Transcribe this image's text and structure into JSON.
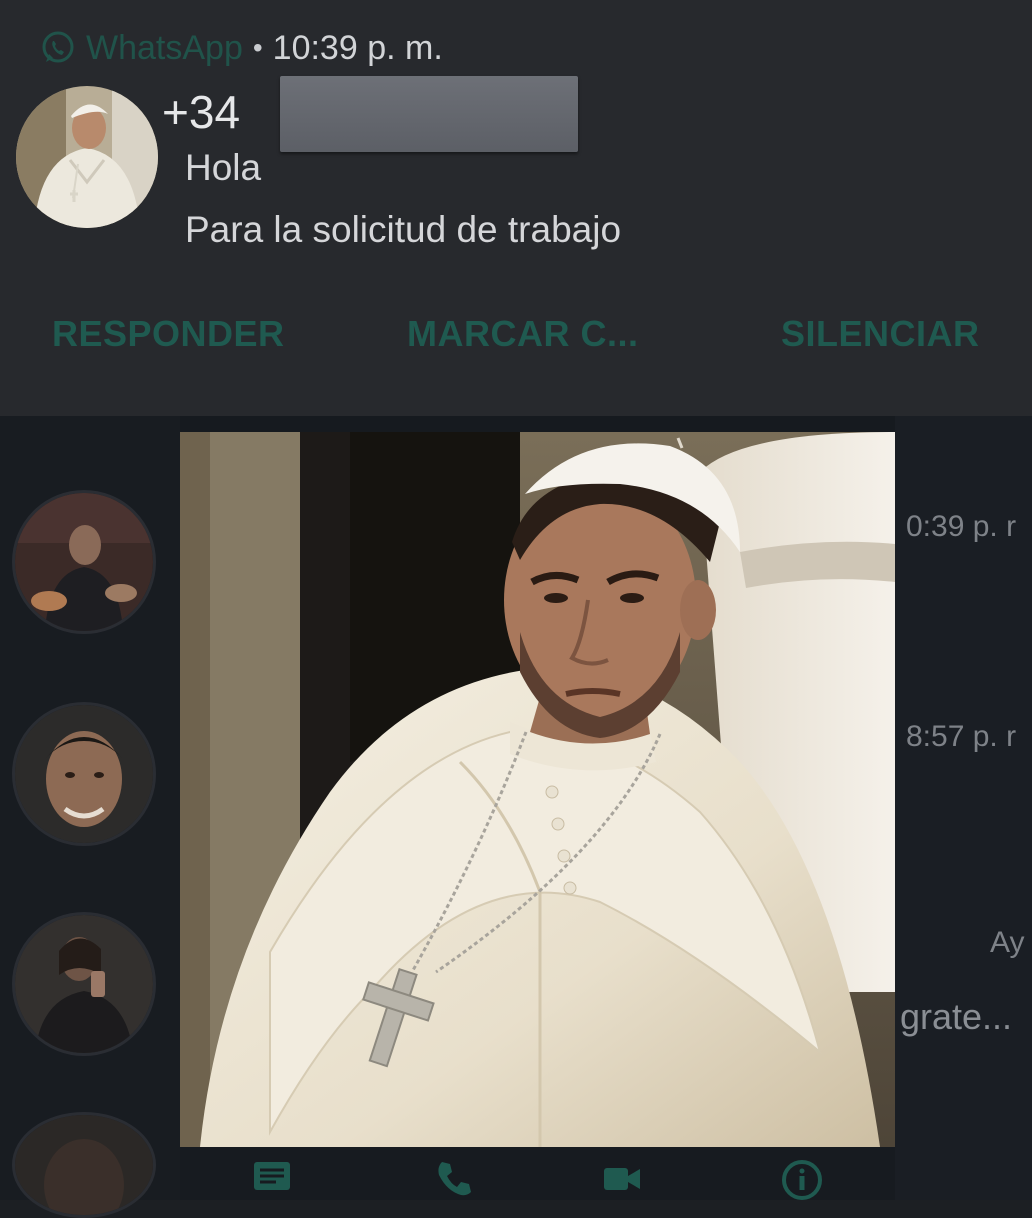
{
  "notification": {
    "app_name": "WhatsApp",
    "separator": "•",
    "time": "10:39 p. m.",
    "sender": "+34",
    "messages": [
      "Hola",
      "Para la solicitud de trabajo"
    ],
    "actions": {
      "reply": "RESPONDER",
      "mark_read": "MARCAR C...",
      "mute": "SILENCIAR"
    }
  },
  "chat_list": {
    "times": [
      "0:39 p. r",
      "8:57 p. r"
    ],
    "snippets": [
      "Ay",
      "grate..."
    ]
  },
  "colors": {
    "notification_bg": "#27292d",
    "action_text": "#1f5a50",
    "chat_bg": "#161a1f"
  }
}
